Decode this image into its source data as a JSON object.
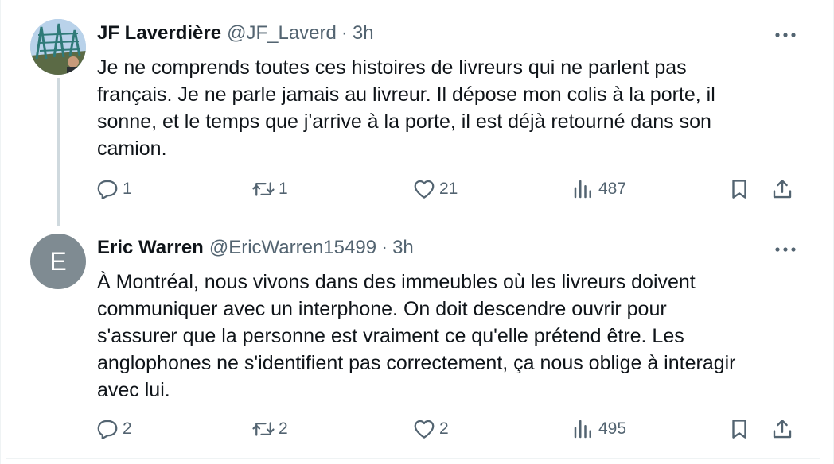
{
  "tweets": [
    {
      "display_name": "JF Laverdière",
      "handle": "@JF_Laverd",
      "separator": "·",
      "time": "3h",
      "text": "Je ne comprends toutes ces histoires de livreurs qui ne parlent pas\nfrançais. Je ne parle jamais au livreur. Il dépose mon colis à la porte, il\nsonne, et le temps que j'arrive à la porte, il est déjà retourné dans son\ncamion.",
      "avatar": {
        "type": "photo"
      },
      "replies": "1",
      "reposts": "1",
      "likes": "21",
      "views": "487"
    },
    {
      "display_name": "Eric Warren",
      "handle": "@EricWarren15499",
      "separator": "·",
      "time": "3h",
      "text": "À Montréal, nous vivons dans des immeubles où les livreurs doivent\ncommuniquer avec un interphone. On doit descendre ouvrir pour\ns'assurer que la personne est vraiment ce qu'elle prétend être. Les\nanglophones ne s'identifient pas correctement, ça nous oblige à interagir\navec lui.",
      "avatar": {
        "type": "letter",
        "letter": "E",
        "color": "#7f8b92"
      },
      "replies": "2",
      "reposts": "2",
      "likes": "2",
      "views": "495"
    }
  ],
  "icons": {
    "more": "more-horizontal-icon",
    "reply": "reply-icon",
    "repost": "repost-icon",
    "like": "heart-icon",
    "views": "views-chart-icon",
    "bookmark": "bookmark-icon",
    "share": "share-icon"
  },
  "colors": {
    "text": "#0f1419",
    "secondary": "#536471",
    "thread_line": "#cfd9de",
    "border": "#eff3f4"
  }
}
